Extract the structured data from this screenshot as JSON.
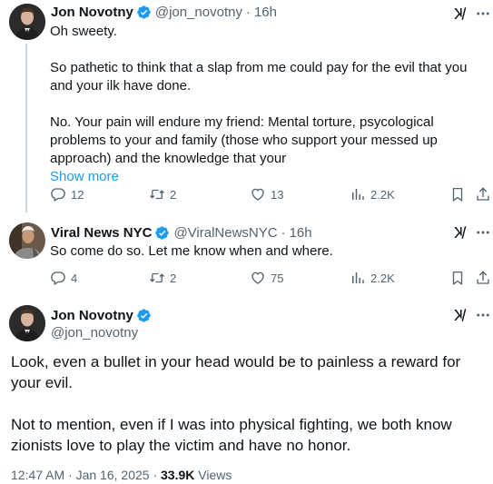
{
  "reply1": {
    "display_name": "Jon Novotny",
    "handle": "@jon_novotny",
    "dot": "·",
    "time": "16h",
    "paragraphs": [
      "Oh sweety.",
      "So pathetic to think that a slap from me could pay for the evil that you and your ilk have done.",
      "No. Your pain will endure my friend: Mental torture, psycological problems to your and family (those who support your messed up approach) and the knowledge that your"
    ],
    "show_more": "Show more",
    "replies": "12",
    "reposts": "2",
    "likes": "13",
    "views": "2.2K"
  },
  "reply2": {
    "display_name": "Viral News NYC",
    "handle": "@ViralNewsNYC",
    "dot": "·",
    "time": "16h",
    "text": "So come do so. Let me know when and where.",
    "replies": "4",
    "reposts": "2",
    "likes": "75",
    "views": "2.2K"
  },
  "main": {
    "display_name": "Jon Novotny",
    "handle": "@jon_novotny",
    "paragraphs": [
      "Look, even a bullet in your head would be to painless a reward for your evil.",
      "Not to mention, even if I was into physical fighting, we both know zionists love to play the victim and have no honor."
    ],
    "timestamp": "12:47 AM · Jan 16, 2025 · ",
    "views_count": "33.9K",
    "views_label": " Views"
  },
  "icons": {
    "verified": "verified-badge-icon",
    "grok": "grok-icon",
    "more": "more-icon",
    "reply": "reply-icon",
    "repost": "repost-icon",
    "like": "heart-icon",
    "views": "views-icon",
    "bookmark": "bookmark-icon",
    "share": "share-icon"
  },
  "colors": {
    "link": "#1d9bf0",
    "verified": "#1d9bf0",
    "secondary_text": "#536471",
    "primary_text": "#0f1419",
    "thread_line": "#cfd9de"
  }
}
